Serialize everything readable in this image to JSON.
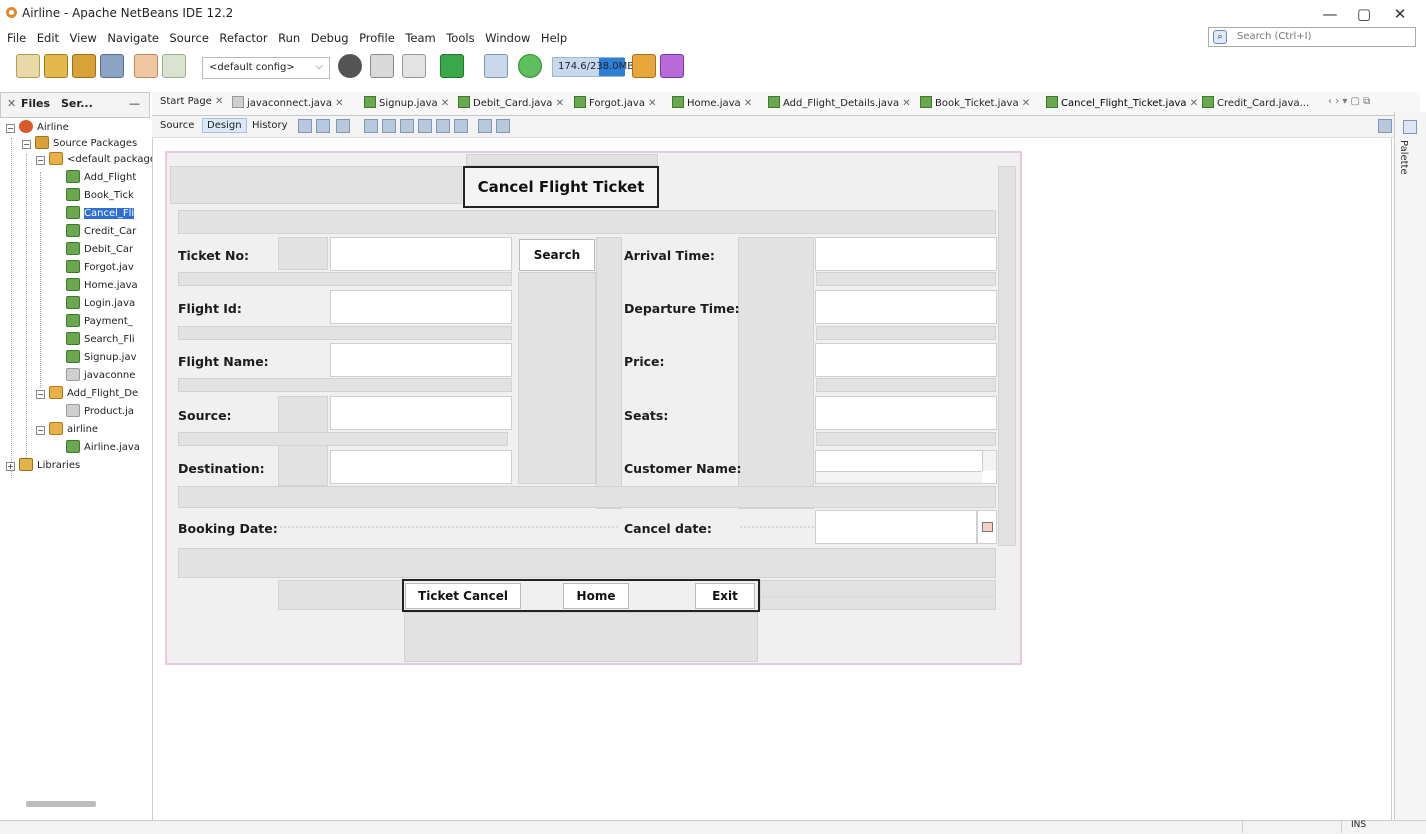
{
  "window": {
    "title": "Airline - Apache NetBeans IDE 12.2",
    "minimize": "—",
    "restore": "▢",
    "close": "✕"
  },
  "menu": [
    "File",
    "Edit",
    "View",
    "Navigate",
    "Source",
    "Refactor",
    "Run",
    "Debug",
    "Profile",
    "Team",
    "Tools",
    "Window",
    "Help"
  ],
  "search": {
    "placeholder": "Search (Ctrl+I)"
  },
  "toolbar": {
    "config": "<default config>",
    "memory": "174.6/238.0MB"
  },
  "left_panel": {
    "tab_files": "Files",
    "tab_services": "Ser..."
  },
  "tree": {
    "project": "Airline",
    "source_packages": "Source Packages",
    "default_package": "<default package>",
    "files": [
      "Add_Flight",
      "Book_Tick",
      "Cancel_Fli",
      "Credit_Car",
      "Debit_Car",
      "Forgot.jav",
      "Home.java",
      "Login.java",
      "Payment_",
      "Search_Fli",
      "Signup.jav",
      "javaconne"
    ],
    "add_flight_pkg": "Add_Flight_De",
    "product": "Product.ja",
    "airline_pkg": "airline",
    "airline_java": "Airline.java",
    "libraries": "Libraries"
  },
  "editor_tabs": [
    "Start Page",
    "javaconnect.java",
    "Signup.java",
    "Debit_Card.java",
    "Forgot.java",
    "Home.java",
    "Add_Flight_Details.java",
    "Book_Ticket.java",
    "Cancel_Flight_Ticket.java",
    "Credit_Card.java..."
  ],
  "sub_tabs": {
    "source": "Source",
    "design": "Design",
    "history": "History"
  },
  "palette": "Palette",
  "status": {
    "mode": "INS"
  },
  "form": {
    "title": "Cancel Flight Ticket",
    "labels": {
      "ticket_no": "Ticket No:",
      "flight_id": "Flight Id:",
      "flight_name": "Flight Name:",
      "source": "Source:",
      "destination": "Destination:",
      "booking_date": "Booking Date:",
      "arrival_time": "Arrival Time:",
      "departure_time": "Departure Time:",
      "price": "Price:",
      "seats": "Seats:",
      "customer_name": "Customer Name:",
      "cancel_date": "Cancel date:"
    },
    "buttons": {
      "search": "Search",
      "ticket_cancel": "Ticket Cancel",
      "home": "Home",
      "exit": "Exit"
    }
  }
}
